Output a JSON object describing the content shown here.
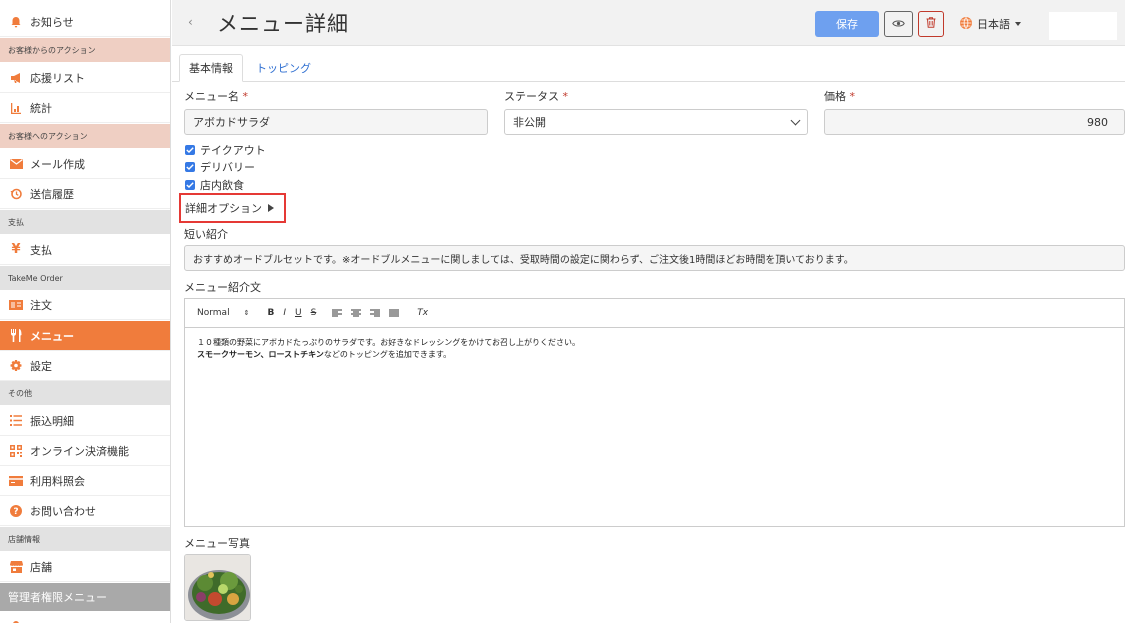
{
  "sidebar": {
    "notice": "お知らせ",
    "sec_from_customer": "お客様からのアクション",
    "support_list": "応援リスト",
    "stats": "統計",
    "sec_to_customer": "お客様へのアクション",
    "mail_compose": "メール作成",
    "send_history": "送信履歴",
    "sec_payment": "支払",
    "payment": "支払",
    "sec_takeme": "TakeMe Order",
    "orders": "注文",
    "menu": "メニュー",
    "settings": "設定",
    "sec_other": "その他",
    "transfer": "振込明細",
    "online_pay": "オンライン決済機能",
    "fee_inquiry": "利用料照会",
    "contact": "お問い合わせ",
    "sec_store": "店舗情報",
    "store": "店舗",
    "sec_admin": "管理者権限メニュー"
  },
  "header": {
    "back": "‹",
    "title": "メニュー詳細",
    "save": "保存",
    "language": "日本語"
  },
  "tabs": {
    "basic": "基本情報",
    "topping": "トッピング"
  },
  "form": {
    "name_label": "メニュー名",
    "name_value": "アボカドサラダ",
    "status_label": "ステータス",
    "status_value": "非公開",
    "price_label": "価格",
    "price_value": "980",
    "required_mark": "*",
    "checkboxes": [
      "テイクアウト",
      "デリバリー",
      "店内飲食"
    ],
    "advanced": "詳細オプション",
    "short_label": "短い紹介",
    "short_value": "おすすめオードブルセットです。※オードブルメニューに関しましては、受取時間の設定に関わらず、ご注文後1時間ほどお時間を頂いております。",
    "desc_label": "メニュー紹介文",
    "desc_line1": "１０種類の野菜にアボカドたっぷりのサラダです。お好きなドレッシングをかけてお召し上がりください。",
    "desc_line2_bold": "スモークサーモン、ローストチキン",
    "desc_line2_rest": "などのトッピングを追加できます。",
    "photo_label": "メニュー写真"
  },
  "toolbar": {
    "format": "Normal",
    "bold": "B",
    "italic": "I",
    "underline": "U",
    "strike": "S",
    "clear": "Tx"
  },
  "colors": {
    "accent": "#f07c3c",
    "save": "#6ea0ef",
    "link": "#2f6fd1",
    "danger": "#c0392b"
  }
}
